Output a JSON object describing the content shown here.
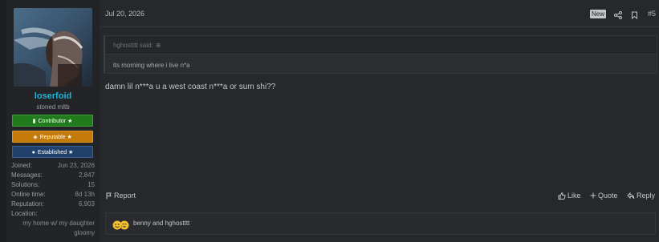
{
  "user": {
    "name": "loserfoid",
    "title": "stoned mltb",
    "banners": [
      {
        "label": "Contributor ★"
      },
      {
        "label": "Reputable ★"
      },
      {
        "label": "Established ★"
      }
    ],
    "stats": {
      "joined_label": "Joined:",
      "joined": "Jun 23, 2026",
      "messages_label": "Messages:",
      "messages": "2,847",
      "solutions_label": "Solutions:",
      "solutions": "15",
      "online_label": "Online time:",
      "online": "8d 13h",
      "reputation_label": "Reputation:",
      "reputation": "6,903",
      "location_label": "Location:",
      "location": "my home w/ my daughter gloomy"
    }
  },
  "post": {
    "date": "Jul 20, 2026",
    "badge": "New",
    "number": "#5",
    "quote": {
      "author": "hghostttt said:",
      "text": "its morning where i live n*a"
    },
    "message": "damn lil n***a u a west coast n***a or sum shi??",
    "actions": {
      "report": "Report",
      "like": "Like",
      "quote": "Quote",
      "reply": "Reply"
    },
    "reactions_text": "benny and hghostttt"
  },
  "colors": {
    "username": "#1cb5d8",
    "contributor": "#1f7b1b",
    "reputable": "#c47a08",
    "established": "#21406c"
  },
  "icons": [
    "share-icon",
    "bookmark-icon",
    "flag-icon",
    "like-icon",
    "plus-icon",
    "reply-icon",
    "reaction-icons"
  ]
}
